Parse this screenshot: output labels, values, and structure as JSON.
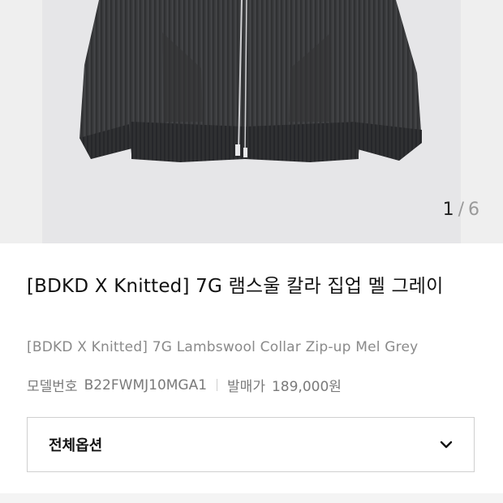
{
  "gallery": {
    "current": "1",
    "separator": "/",
    "total": "6"
  },
  "product": {
    "title": "[BDKD X Knitted] 7G 램스울 칼라 집업 멜 그레이",
    "subtitle": "[BDKD X Knitted] 7G Lambswool Collar Zip-up Mel Grey",
    "model_label": "모델번호",
    "model_value": "B22FWMJ10MGA1",
    "price_label": "발매가",
    "price_value": "189,000원"
  },
  "options": {
    "label": "전체옵션",
    "icon": "chevron-down-icon"
  },
  "colors": {
    "image_background": "#e6e6e8",
    "garment": "#3a3b3d"
  }
}
